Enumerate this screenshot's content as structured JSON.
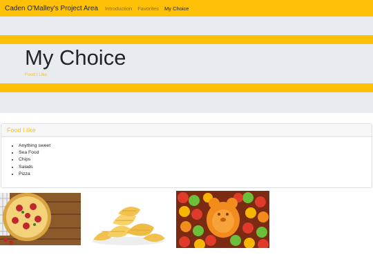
{
  "navbar": {
    "brand": "Caden O'Malley's Project Area",
    "links": [
      {
        "label": "Introduction",
        "active": false
      },
      {
        "label": "Favorites",
        "active": false
      },
      {
        "label": "My Choice",
        "active": true
      }
    ]
  },
  "jumbotron": {
    "title": "My Choice",
    "subtitle": "Food I Like"
  },
  "card": {
    "header": "Food I like",
    "items": [
      "Anything sweet",
      "Sea Food",
      "Chips",
      "Salads",
      "Pizza"
    ]
  },
  "images": [
    {
      "name": "pizza-image",
      "subject": "pizza"
    },
    {
      "name": "chips-image",
      "subject": "chips"
    },
    {
      "name": "gummy-bears-image",
      "subject": "gummy bears"
    }
  ],
  "colors": {
    "accent": "#ffc107",
    "band": "#e9ecef",
    "text": "#212529"
  }
}
